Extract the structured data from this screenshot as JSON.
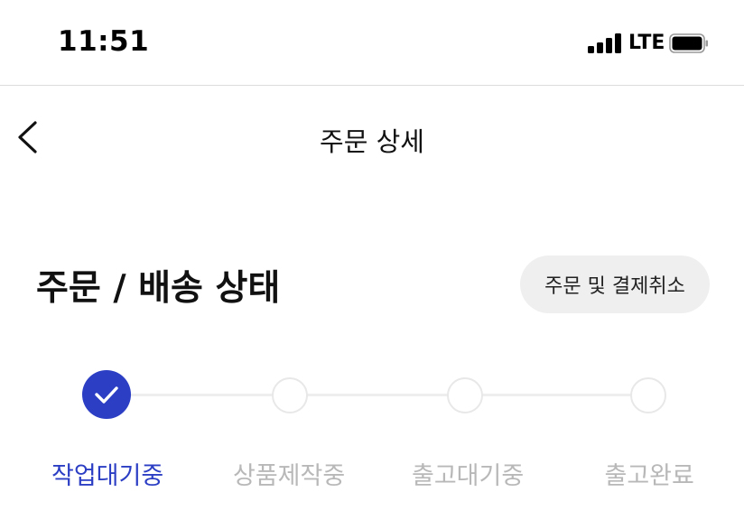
{
  "status_bar": {
    "time": "11:51",
    "network": "LTE"
  },
  "nav": {
    "title": "주문 상세"
  },
  "order_status": {
    "title": "주문 / 배송 상태",
    "cancel_button": "주문 및 결제취소"
  },
  "steps": [
    {
      "label": "작업대기중",
      "active": true
    },
    {
      "label": "상품제작중",
      "active": false
    },
    {
      "label": "출고대기중",
      "active": false
    },
    {
      "label": "출고완료",
      "active": false
    }
  ],
  "colors": {
    "accent": "#2b3ec4",
    "inactive_text": "#b8b8b8",
    "inactive_border": "#e8e8e8"
  }
}
